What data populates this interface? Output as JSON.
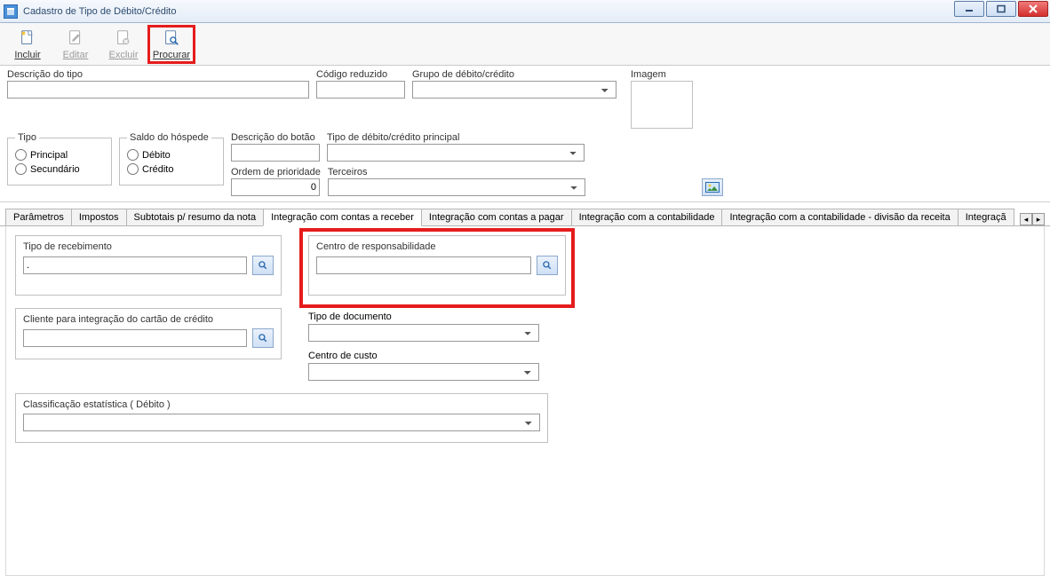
{
  "window": {
    "title": "Cadastro de Tipo de Débito/Crédito"
  },
  "toolbar": {
    "incluir": "Incluir",
    "editar": "Editar",
    "excluir": "Excluir",
    "procurar": "Procurar"
  },
  "form": {
    "descricao_tipo_label": "Descrição do tipo",
    "descricao_tipo_value": "",
    "codigo_reduzido_label": "Código reduzido",
    "codigo_reduzido_value": "",
    "grupo_label": "Grupo de débito/crédito",
    "grupo_value": "",
    "imagem_label": "Imagem",
    "tipo_legend": "Tipo",
    "tipo_principal": "Principal",
    "tipo_secundario": "Secundário",
    "saldo_legend": "Saldo do hóspede",
    "saldo_debito": "Débito",
    "saldo_credito": "Crédito",
    "descricao_botao_label": "Descrição do botão",
    "descricao_botao_value": "",
    "principal_label": "Tipo de débito/crédito principal",
    "principal_value": "",
    "ordem_label": "Ordem de prioridade",
    "ordem_value": "0",
    "terceiros_label": "Terceiros",
    "terceiros_value": ""
  },
  "tabs": {
    "t0": "Parâmetros",
    "t1": "Impostos",
    "t2": "Subtotais p/ resumo da nota",
    "t3": "Integração com contas a receber",
    "t4": "Integração com contas a pagar",
    "t5": "Integração com a contabilidade",
    "t6": "Integração com a contabilidade - divisão da receita",
    "t7": "Integraçã"
  },
  "content": {
    "tipo_recebimento_label": "Tipo de recebimento",
    "tipo_recebimento_value": ".",
    "cliente_cartao_label": "Cliente para integração do cartão de crédito",
    "cliente_cartao_value": "",
    "centro_resp_label": "Centro de responsabilidade",
    "centro_resp_value": "",
    "tipo_documento_label": "Tipo de documento",
    "tipo_documento_value": "",
    "centro_custo_label": "Centro de custo",
    "centro_custo_value": "",
    "classif_label": "Classificação estatística ( Débito )",
    "classif_value": ""
  }
}
